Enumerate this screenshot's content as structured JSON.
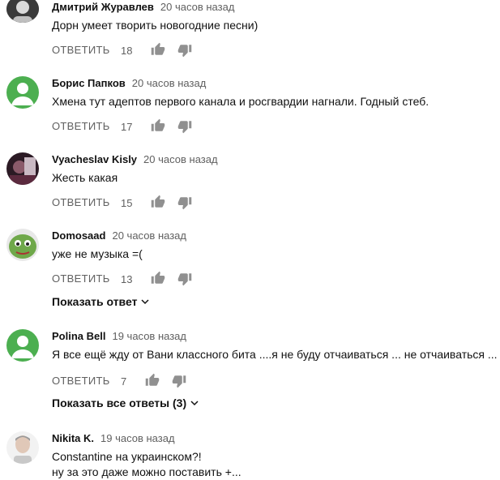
{
  "comments": [
    {
      "author": "Дмитрий Журавлев",
      "time": "20 часов назад",
      "text": "Дорн умеет творить новогодние песни)",
      "reply_label": "ОТВЕТИТЬ",
      "likes": "18",
      "avatar_color": "#3a3a3a"
    },
    {
      "author": "Борис Папков",
      "time": "20 часов назад",
      "text": "Хмена тут адептов первого канала и росгвардии нагнали. Годный стеб.",
      "reply_label": "ОТВЕТИТЬ",
      "likes": "17",
      "avatar_color": "#4caf50"
    },
    {
      "author": "Vyacheslav Kisly",
      "time": "20 часов назад",
      "text": "Жесть какая",
      "reply_label": "ОТВЕТИТЬ",
      "likes": "15",
      "avatar_color": "#5b2a3e"
    },
    {
      "author": "Domosaad",
      "time": "20 часов назад",
      "text": "уже не музыка =(",
      "reply_label": "ОТВЕТИТЬ",
      "likes": "13",
      "avatar_color": "#6fa84a",
      "replies_label": "Показать ответ"
    },
    {
      "author": "Polina Bell",
      "time": "19 часов назад",
      "text": "Я все ещё жду от Вани классного бита ....я не буду отчаиваться ... не отчаиваться ...",
      "reply_label": "ОТВЕТИТЬ",
      "likes": "7",
      "avatar_color": "#4caf50",
      "replies_label": "Показать все ответы (3)"
    },
    {
      "author": "Nikita K.",
      "time": "19 часов назад",
      "text_line1": "Constantine на украинском?!",
      "text_line2": "ну за это даже можно поставить +...",
      "avatar_color": "#c8c8c8"
    }
  ],
  "colors": {
    "text_primary": "#111111",
    "text_secondary": "#606060",
    "icon": "#909090"
  },
  "icons": [
    "thumb-up-icon",
    "thumb-down-icon",
    "chevron-down-icon"
  ]
}
